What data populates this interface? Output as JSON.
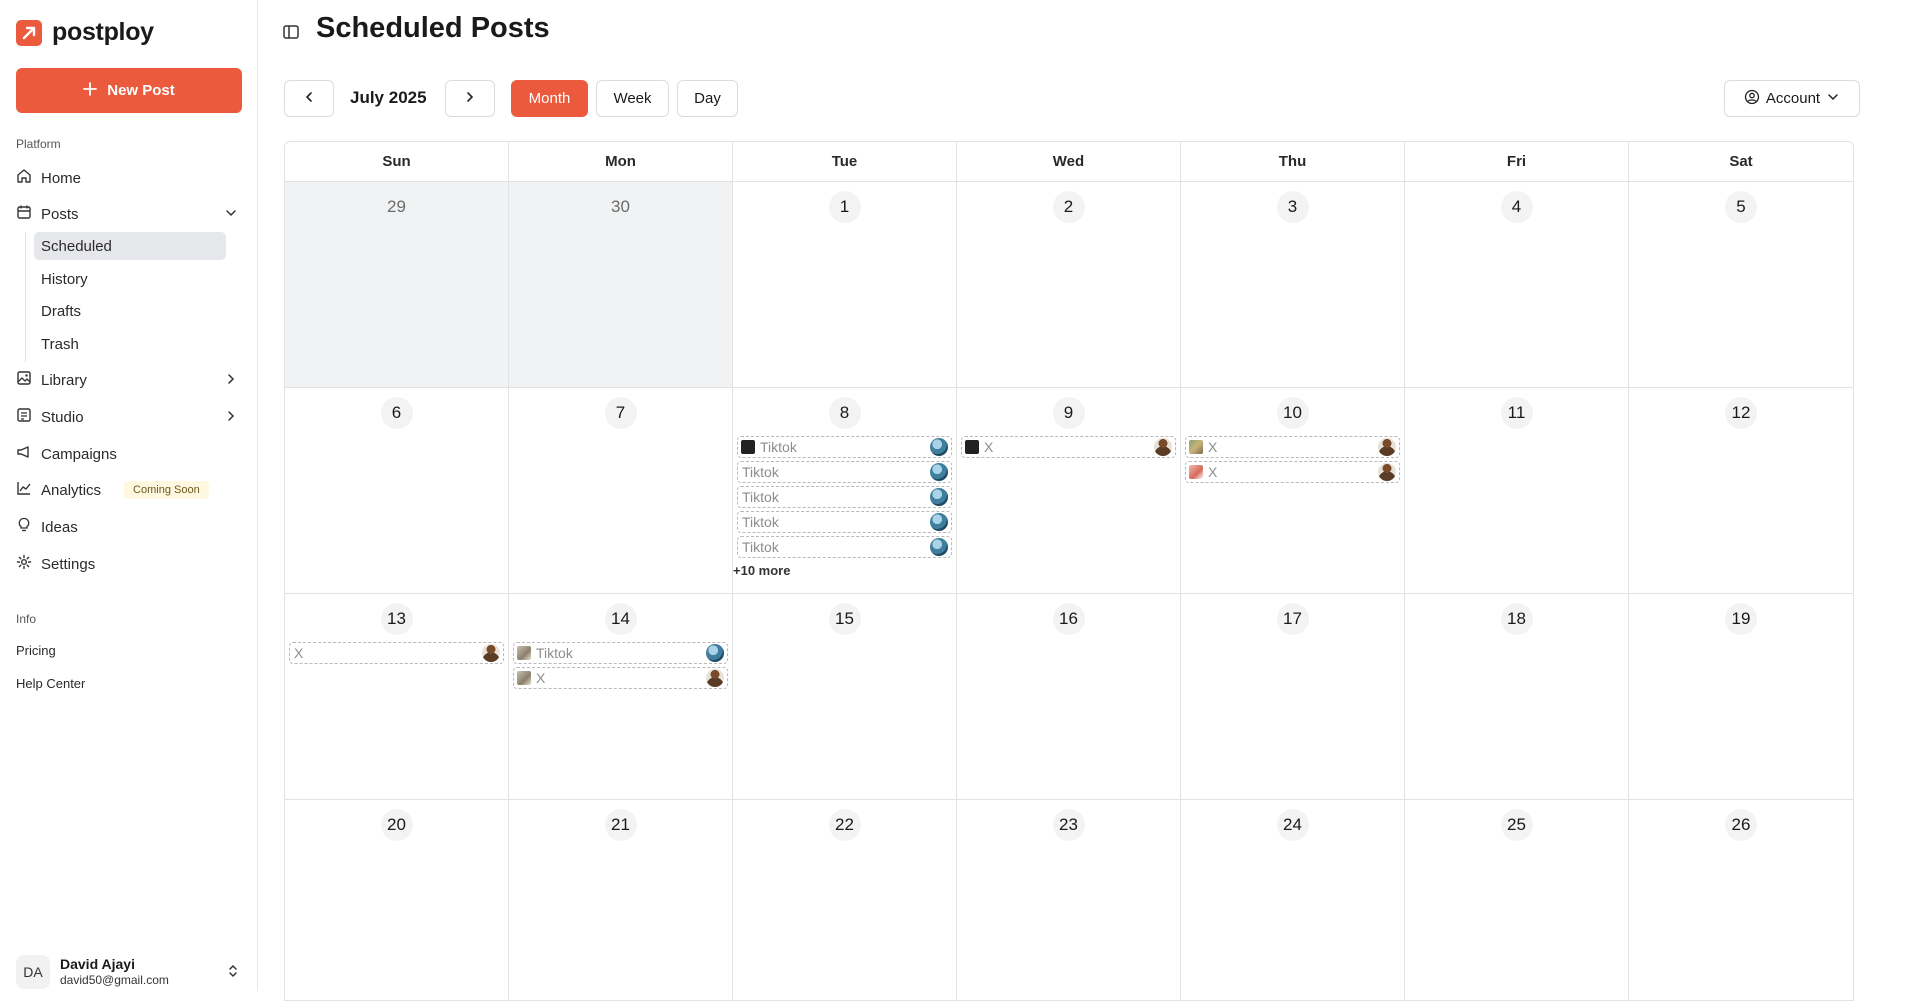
{
  "brand": {
    "name": "postploy",
    "accent": "#ec5a3e"
  },
  "sidebar": {
    "new_post_label": "New Post",
    "platform_label": "Platform",
    "home": "Home",
    "posts": "Posts",
    "posts_sub": {
      "scheduled": "Scheduled",
      "history": "History",
      "drafts": "Drafts",
      "trash": "Trash"
    },
    "library": "Library",
    "studio": "Studio",
    "campaigns": "Campaigns",
    "analytics": "Analytics",
    "analytics_badge": "Coming Soon",
    "ideas": "Ideas",
    "settings": "Settings",
    "info_label": "Info",
    "pricing": "Pricing",
    "help_center": "Help Center",
    "user": {
      "initials": "DA",
      "name": "David Ajayi",
      "email": "david50@gmail.com"
    }
  },
  "header": {
    "title": "Scheduled Posts",
    "month_label": "July 2025",
    "views": {
      "month": "Month",
      "week": "Week",
      "day": "Day"
    },
    "active_view": "Month",
    "account_label": "Account"
  },
  "calendar": {
    "weekdays": [
      "Sun",
      "Mon",
      "Tue",
      "Wed",
      "Thu",
      "Fri",
      "Sat"
    ],
    "days": [
      {
        "num": "29",
        "muted": true,
        "posts": []
      },
      {
        "num": "30",
        "muted": true,
        "posts": []
      },
      {
        "num": "1",
        "posts": []
      },
      {
        "num": "2",
        "posts": []
      },
      {
        "num": "3",
        "posts": []
      },
      {
        "num": "4",
        "posts": []
      },
      {
        "num": "5",
        "posts": []
      },
      {
        "num": "6",
        "posts": []
      },
      {
        "num": "7",
        "posts": []
      },
      {
        "num": "8",
        "posts": [
          {
            "label": "Tiktok",
            "thumb": "dark",
            "account": "tt"
          },
          {
            "label": "Tiktok",
            "account": "tt"
          },
          {
            "label": "Tiktok",
            "account": "tt"
          },
          {
            "label": "Tiktok",
            "account": "tt"
          },
          {
            "label": "Tiktok",
            "account": "tt"
          }
        ],
        "more": "+10 more"
      },
      {
        "num": "9",
        "posts": [
          {
            "label": "X",
            "thumb": "dark",
            "account": "x"
          }
        ]
      },
      {
        "num": "10",
        "posts": [
          {
            "label": "X",
            "thumb": "photo1",
            "account": "x"
          },
          {
            "label": "X",
            "thumb": "photo2",
            "account": "x"
          }
        ]
      },
      {
        "num": "11",
        "posts": []
      },
      {
        "num": "12",
        "posts": []
      },
      {
        "num": "13",
        "posts": [
          {
            "label": "X",
            "account": "x"
          }
        ]
      },
      {
        "num": "14",
        "posts": [
          {
            "label": "Tiktok",
            "thumb": "photo3",
            "account": "tt"
          },
          {
            "label": "X",
            "thumb": "photo3",
            "account": "x"
          }
        ]
      },
      {
        "num": "15",
        "posts": []
      },
      {
        "num": "16",
        "posts": []
      },
      {
        "num": "17",
        "posts": []
      },
      {
        "num": "18",
        "posts": []
      },
      {
        "num": "19",
        "posts": []
      },
      {
        "num": "20",
        "posts": []
      },
      {
        "num": "21",
        "posts": []
      },
      {
        "num": "22",
        "posts": []
      },
      {
        "num": "23",
        "posts": []
      },
      {
        "num": "24",
        "posts": []
      },
      {
        "num": "25",
        "posts": []
      },
      {
        "num": "26",
        "posts": []
      }
    ]
  }
}
